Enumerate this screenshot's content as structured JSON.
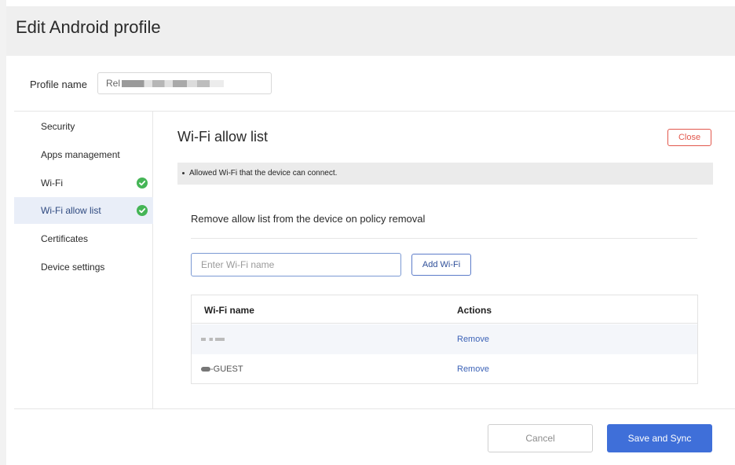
{
  "header": {
    "title": "Edit Android profile"
  },
  "profile": {
    "label": "Profile name",
    "value_visible_prefix": "Rel"
  },
  "sidebar": {
    "items": [
      {
        "label": "Security",
        "active": false,
        "checked": false
      },
      {
        "label": "Apps management",
        "active": false,
        "checked": false
      },
      {
        "label": "Wi-Fi",
        "active": false,
        "checked": true
      },
      {
        "label": "Wi-Fi allow list",
        "active": true,
        "checked": true
      },
      {
        "label": "Certificates",
        "active": false,
        "checked": false
      },
      {
        "label": "Device settings",
        "active": false,
        "checked": false
      }
    ]
  },
  "main": {
    "title": "Wi-Fi allow list",
    "close_label": "Close",
    "info_text": "Allowed Wi-Fi that the device can connect.",
    "remove_label": "Remove allow list from the device on policy removal",
    "wifi_input": {
      "placeholder": "Enter Wi-Fi name",
      "value": ""
    },
    "add_label": "Add Wi-Fi",
    "table": {
      "headers": [
        "Wi-Fi name",
        "Actions"
      ],
      "rows": [
        {
          "name": "",
          "action": "Remove"
        },
        {
          "name": "-GUEST",
          "action": "Remove"
        }
      ]
    }
  },
  "footer": {
    "cancel_label": "Cancel",
    "save_label": "Save and Sync"
  },
  "colors": {
    "primary": "#3f6fd9",
    "danger": "#e2574c",
    "success": "#45b556",
    "active_bg": "#e9eef8"
  }
}
